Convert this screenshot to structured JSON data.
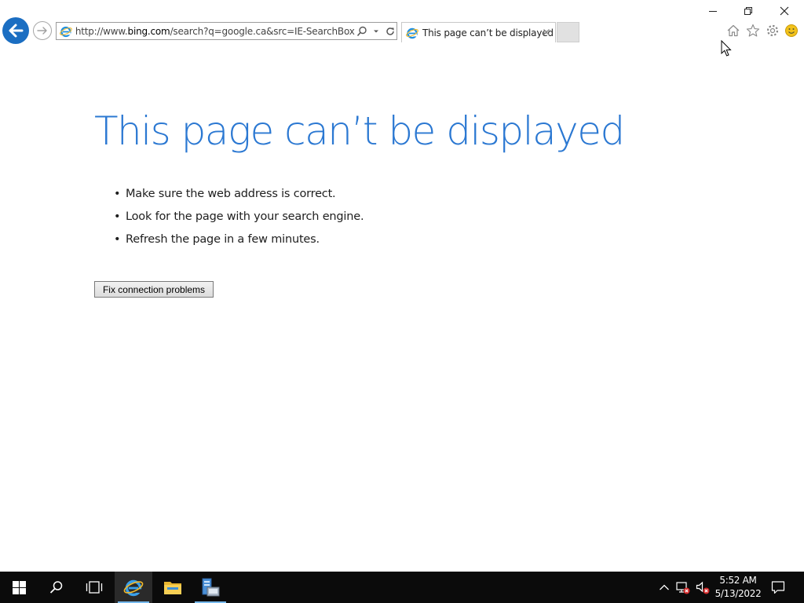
{
  "browser": {
    "address_url_prefix": "http://www.",
    "address_url_domain": "bing.com",
    "address_url_rest": "/search?q=google.ca&src=IE-SearchBox&FOI",
    "tab_title": "This page can’t be displayed",
    "icons": {
      "back": "back-arrow-icon",
      "forward": "forward-arrow-icon",
      "site": "ie-logo-icon",
      "search": "search-icon",
      "dropdown": "chevron-down-icon",
      "refresh": "refresh-icon",
      "close_tab": "close-icon",
      "home": "home-icon",
      "favorites": "star-icon",
      "tools": "gear-icon",
      "feedback": "smiley-icon"
    },
    "accent_color": "#1b6ec2"
  },
  "window": {
    "minimize": "minimize-icon",
    "restore": "restore-icon",
    "close": "close-icon"
  },
  "error_page": {
    "title": "This page can’t be displayed",
    "title_color": "#2b78d2",
    "bullet": "•",
    "tips": [
      "Make sure the web address is correct.",
      "Look for the page with your search engine.",
      "Refresh the page in a few minutes."
    ],
    "fix_button_label": "Fix connection problems"
  },
  "taskbar": {
    "items": [
      "start-icon",
      "search-icon",
      "task-view-icon",
      "internet-explorer-icon",
      "file-explorer-icon",
      "server-manager-icon"
    ],
    "active_item": "internet-explorer-icon",
    "tray": [
      "chevron-up-icon",
      "network-error-icon",
      "volume-muted-icon",
      "notification-icon"
    ],
    "clock_time": "5:52 AM",
    "clock_date": "5/13/2022"
  }
}
